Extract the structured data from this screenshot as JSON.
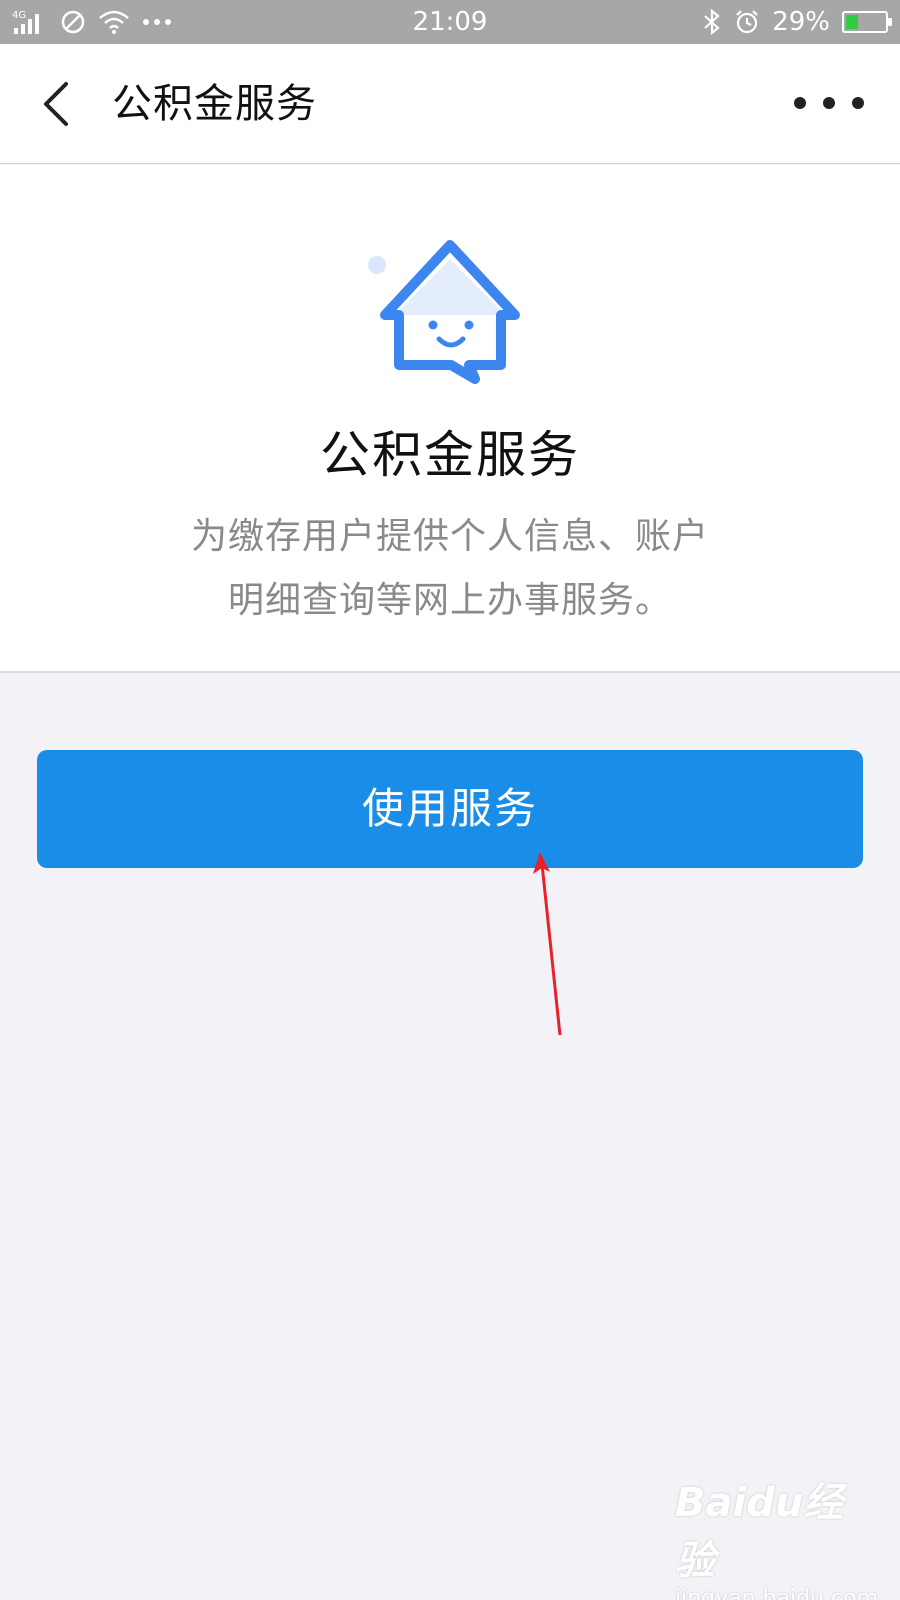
{
  "status_bar": {
    "network": "4G",
    "time": "21:09",
    "battery": "29%",
    "battery_level": 0.29
  },
  "nav": {
    "title": "公积金服务",
    "back_icon": "chevron-left-icon",
    "more_icon": "more-horizontal-icon"
  },
  "intro": {
    "title": "公积金服务",
    "description_line1": "为缴存用户提供个人信息、账户",
    "description_line2": "明细查询等网上办事服务。",
    "icon": "house-smile-icon"
  },
  "action": {
    "use_service_label": "使用服务"
  },
  "watermark": {
    "brand": "Baidu经验",
    "url": "jingyan.baidu.com"
  },
  "colors": {
    "primary": "#1a8de8",
    "icon_blue": "#3d86f0",
    "annotation_red": "#e8202a",
    "background": "#f3f3f7"
  }
}
